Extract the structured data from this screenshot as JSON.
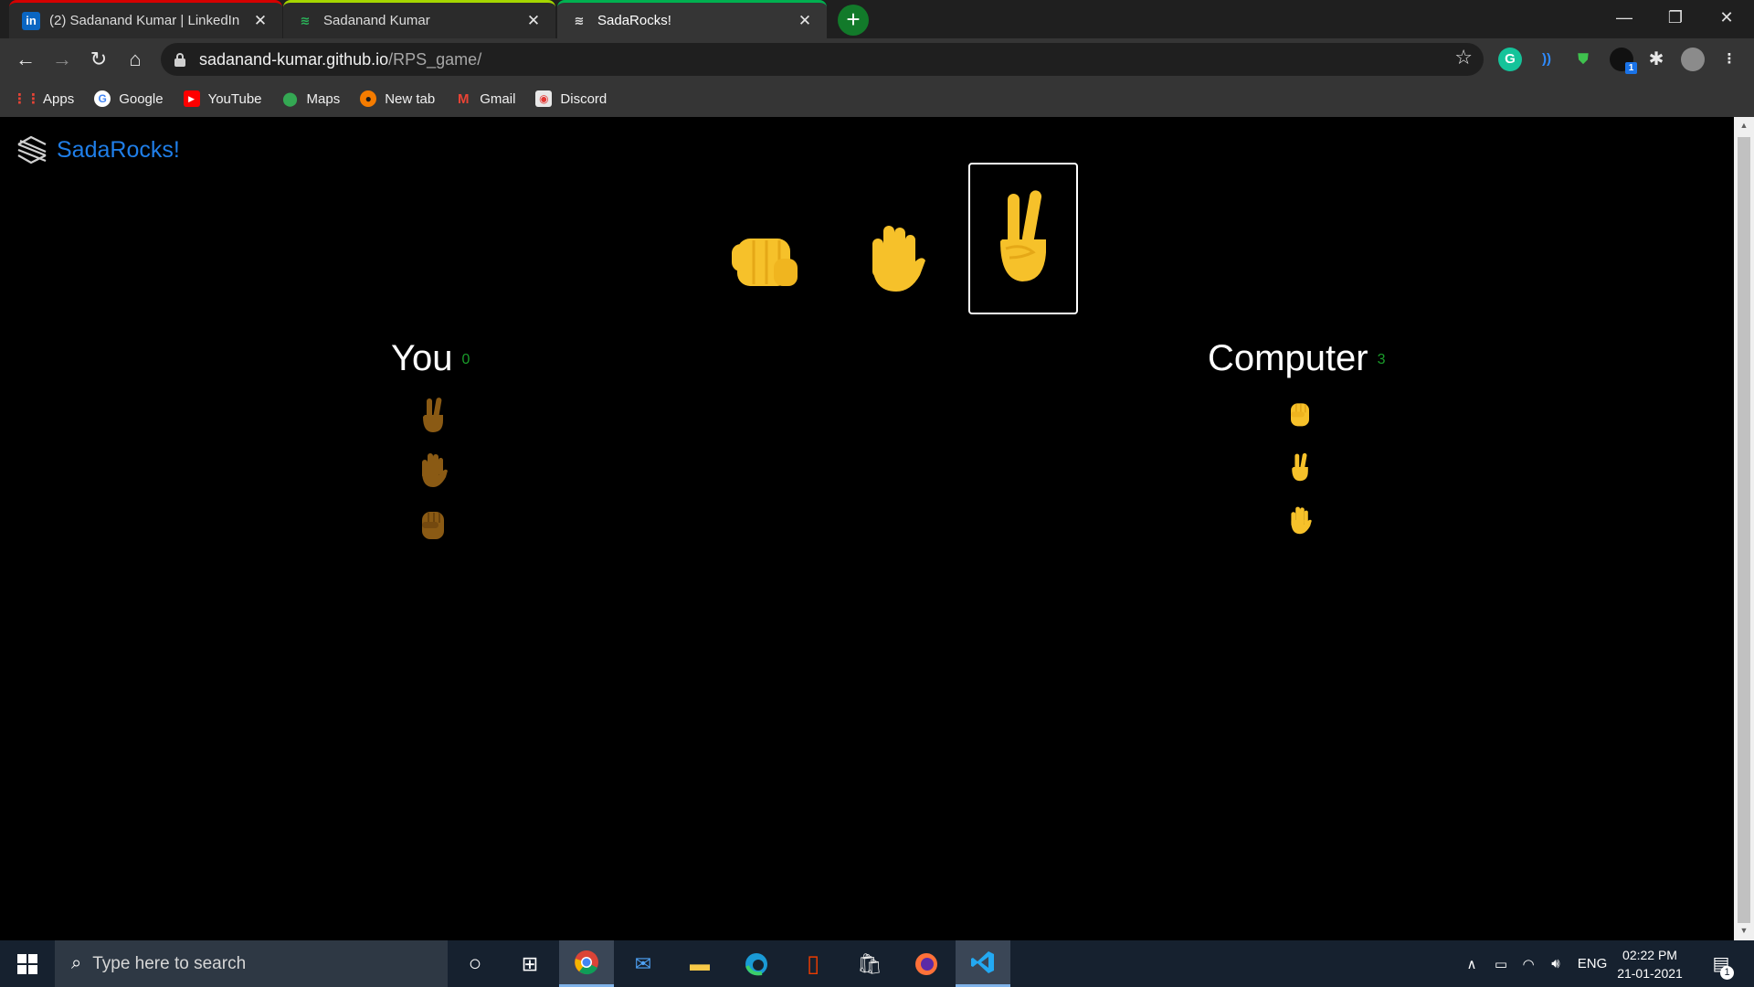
{
  "browser": {
    "tabs": [
      {
        "title": "(2) Sadanand Kumar | LinkedIn",
        "icon": "linkedin-icon",
        "accent": "#d50000"
      },
      {
        "title": "Sadanand Kumar",
        "icon": "sada-logo-icon",
        "accent": "#a5d600"
      },
      {
        "title": "SadaRocks!",
        "icon": "sada-logo-icon",
        "accent": "#00b050"
      }
    ],
    "new_tab": "+",
    "url_host": "sadanand-kumar.github.io",
    "url_path": "/RPS_game/",
    "bookmarks": [
      {
        "label": "Apps",
        "icon": "apps-grid-icon"
      },
      {
        "label": "Google",
        "icon": "google-icon"
      },
      {
        "label": "YouTube",
        "icon": "youtube-icon"
      },
      {
        "label": "Maps",
        "icon": "maps-pin-icon"
      },
      {
        "label": "New tab",
        "icon": "newtab-icon"
      },
      {
        "label": "Gmail",
        "icon": "gmail-icon"
      },
      {
        "label": "Discord",
        "icon": "discord-icon"
      }
    ],
    "extension_badge": "1"
  },
  "game": {
    "brand": "SadaRocks!",
    "choices": [
      {
        "name": "rock",
        "emoji": "👊",
        "selected": false
      },
      {
        "name": "paper",
        "emoji": "✋",
        "selected": false
      },
      {
        "name": "scissors",
        "emoji": "✌️",
        "selected": true
      }
    ],
    "player": {
      "label": "You",
      "score": "0",
      "history": [
        "✌️",
        "✋",
        "✊"
      ]
    },
    "computer": {
      "label": "Computer",
      "score": "3",
      "history": [
        "✊",
        "✌️",
        "✋"
      ]
    },
    "colors": {
      "brand_blue": "#1f7ee8",
      "score_green": "#1a9c2a",
      "emoji_yellow": "#f6c12a",
      "player_emoji_brown": "#8a5a14"
    }
  },
  "taskbar": {
    "search_placeholder": "Type here to search",
    "language": "ENG",
    "time": "02:22 PM",
    "date": "21-01-2021",
    "notification_count": "1"
  }
}
